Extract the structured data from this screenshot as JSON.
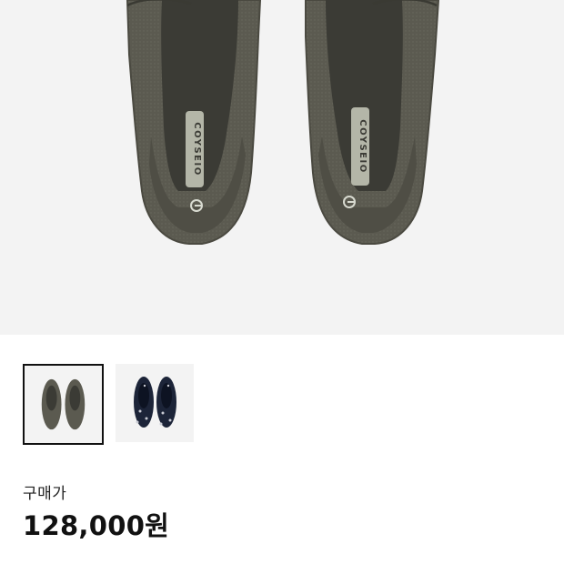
{
  "product": {
    "image_brand_text": "COYSEIO",
    "thumbnails": [
      {
        "color": "#5b5a50",
        "selected": true,
        "variant": "olive-gray"
      },
      {
        "color": "#1c2438",
        "selected": false,
        "variant": "navy-dotted"
      }
    ],
    "price_label": "구매가",
    "price_value": "128,000원"
  }
}
